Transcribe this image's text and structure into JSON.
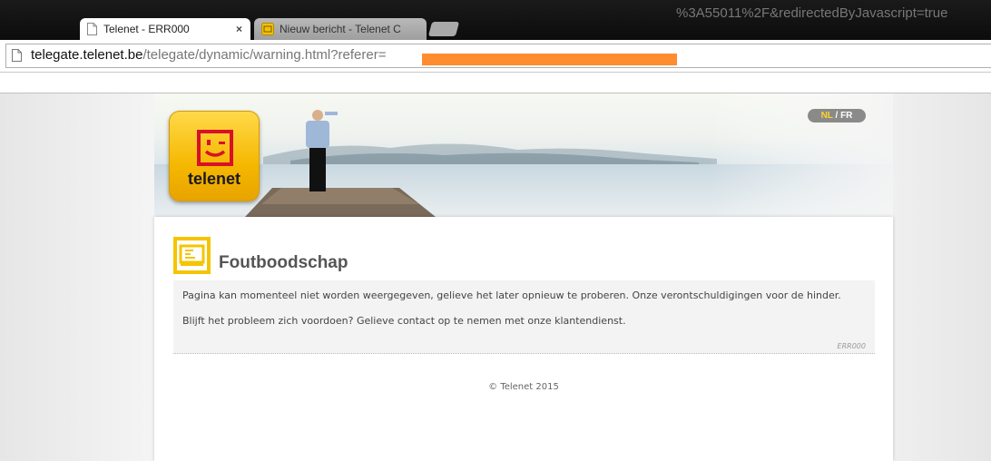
{
  "browser": {
    "tabs": [
      {
        "title": "Telenet - ERR000",
        "active": true,
        "icon": "page-icon"
      },
      {
        "title": "Nieuw bericht - Telenet C",
        "active": false,
        "icon": "mail-icon"
      }
    ],
    "close_glyph": "×",
    "address": {
      "host": "telegate.telenet.be",
      "path": "/telegate/dynamic/warning.html?referer=",
      "tail": "%3A55011%2F&redirectedByJavascript=true",
      "redaction_color": "#ff8c2e"
    }
  },
  "header": {
    "logo_text": "telenet",
    "brand_color": "#f5b800",
    "lang_nl": "NL",
    "lang_sep": " / ",
    "lang_fr": "FR"
  },
  "message": {
    "title": "Foutboodschap",
    "line1": "Pagina kan momenteel niet worden weergegeven, gelieve het later opnieuw te proberen. Onze verontschuldigingen voor de hinder.",
    "line2": "Blijft het probleem zich voordoen? Gelieve contact op te nemen met onze klantendienst.",
    "code": "ERR000"
  },
  "footer": {
    "copyright": "© Telenet 2015"
  }
}
